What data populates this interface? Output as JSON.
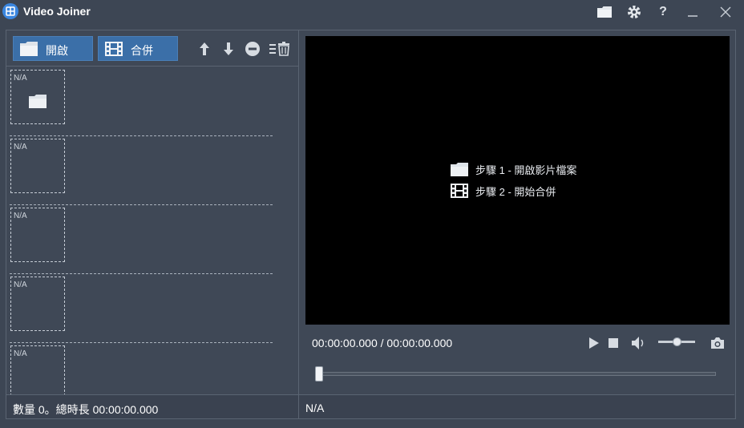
{
  "app": {
    "title": "Video Joiner"
  },
  "toolbar": {
    "open_label": "開啟",
    "merge_label": "合併"
  },
  "files": [
    {
      "thumb_text": "N/A",
      "has_folder_icon": true
    },
    {
      "thumb_text": "N/A",
      "has_folder_icon": false
    },
    {
      "thumb_text": "N/A",
      "has_folder_icon": false
    },
    {
      "thumb_text": "N/A",
      "has_folder_icon": false
    },
    {
      "thumb_text": "N/A",
      "has_folder_icon": false
    }
  ],
  "status_left": "數量 0。總時長 00:00:00.000",
  "preview": {
    "step1": "步驟 1 - 開啟影片檔案",
    "step2": "步驟 2 - 開始合併"
  },
  "playback": {
    "time": "00:00:00.000 / 00:00:00.000",
    "progress": 0,
    "volume": 0.5
  },
  "status_right": "N/A",
  "icons": {
    "titlebar": [
      "folder-icon",
      "gear-icon",
      "help-icon",
      "minimize-icon",
      "close-icon"
    ],
    "toolbar": [
      "arrow-up-icon",
      "arrow-down-icon",
      "remove-icon",
      "clear-list-icon"
    ],
    "controls": [
      "play-icon",
      "stop-icon",
      "volume-icon",
      "camera-icon"
    ]
  },
  "colors": {
    "accent": "#3b6fa8",
    "background": "#3d4654",
    "video_bg": "#000000"
  }
}
